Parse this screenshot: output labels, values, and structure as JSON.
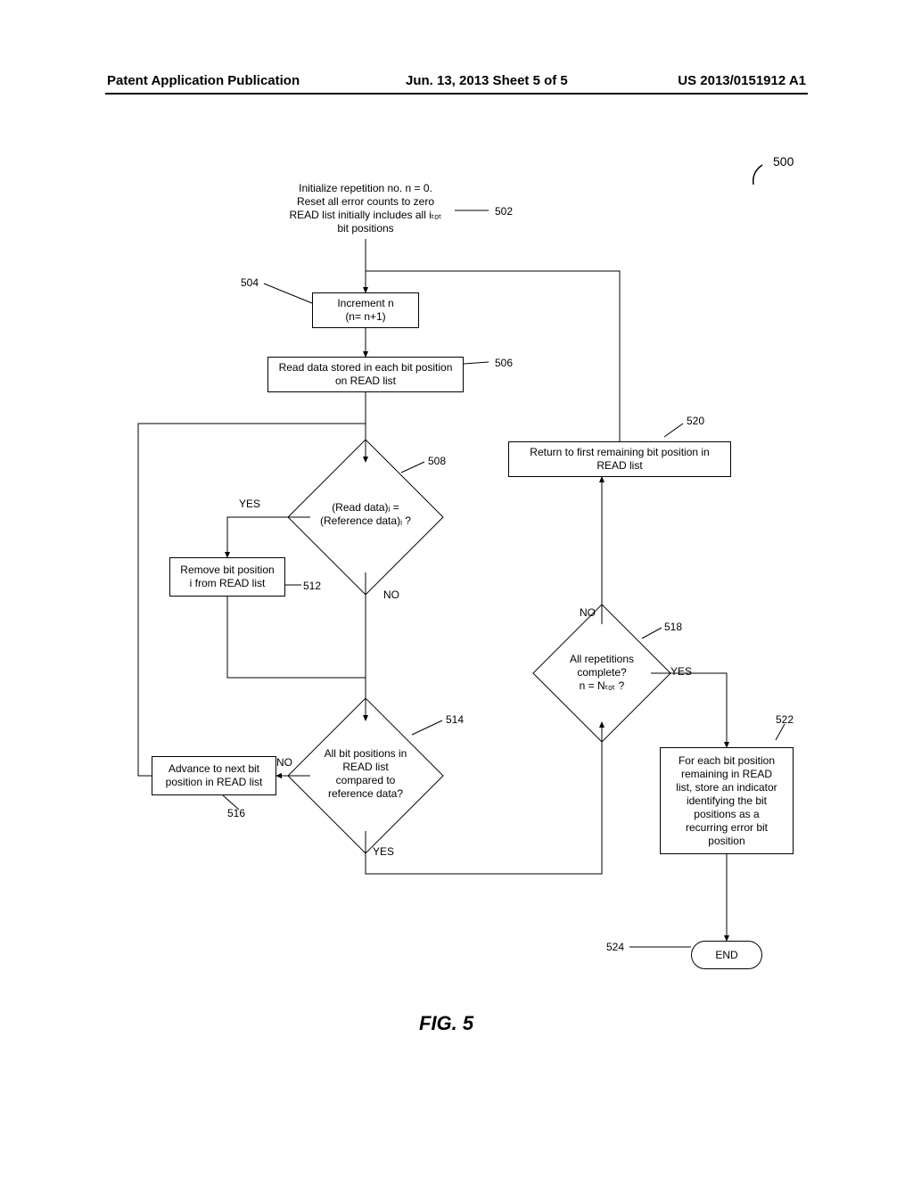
{
  "header": {
    "left": "Patent Application Publication",
    "mid": "Jun. 13, 2013  Sheet 5 of 5",
    "right": "US 2013/0151912 A1"
  },
  "refnums": {
    "n500": "500",
    "n502": "502",
    "n504": "504",
    "n506": "506",
    "n508": "508",
    "n512": "512",
    "n514": "514",
    "n516": "516",
    "n518": "518",
    "n520": "520",
    "n522": "522",
    "n524": "524"
  },
  "blocks": {
    "init": "Initialize repetition no. n = 0.\nReset all error counts to zero\nREAD list initially includes all iₜₒₜ\nbit positions",
    "incr": "Increment n\n(n= n+1)",
    "read": "Read data stored in each bit position\non READ list",
    "cmp": "(Read data)ᵢ =\n(Reference data)ᵢ ?",
    "remove": "Remove bit position\ni from READ list",
    "allbits": "All bit positions in\nREAD list\ncompared to\nreference data?",
    "advance": "Advance to next bit\nposition in READ list",
    "allrep": "All repetitions\ncomplete?\nn = Nₜₒₜ ?",
    "returnfirst": "Return to first remaining bit position in\nREAD list",
    "store": "For each bit position\nremaining in READ\nlist, store an indicator\nidentifying the bit\npositions as a\nrecurring error bit\nposition",
    "end": "END"
  },
  "branches": {
    "yes": "YES",
    "no": "NO"
  },
  "figcap": "FIG. 5"
}
